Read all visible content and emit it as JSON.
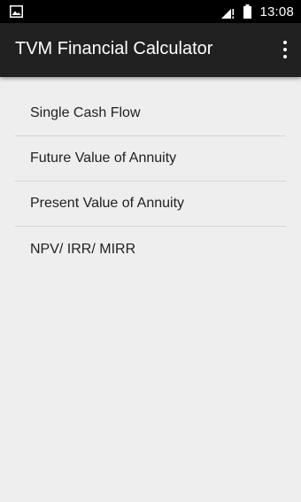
{
  "status_bar": {
    "time": "13:08",
    "icons": [
      "image-icon",
      "signal-icon",
      "battery-icon"
    ]
  },
  "app_bar": {
    "title": "TVM Financial Calculator",
    "overflow_icon": "more-vert-icon",
    "background": "#212121"
  },
  "menu": {
    "items": [
      {
        "label": "Single Cash Flow"
      },
      {
        "label": "Future Value of Annuity"
      },
      {
        "label": "Present Value of Annuity"
      },
      {
        "label": "NPV/ IRR/ MIRR"
      }
    ]
  }
}
